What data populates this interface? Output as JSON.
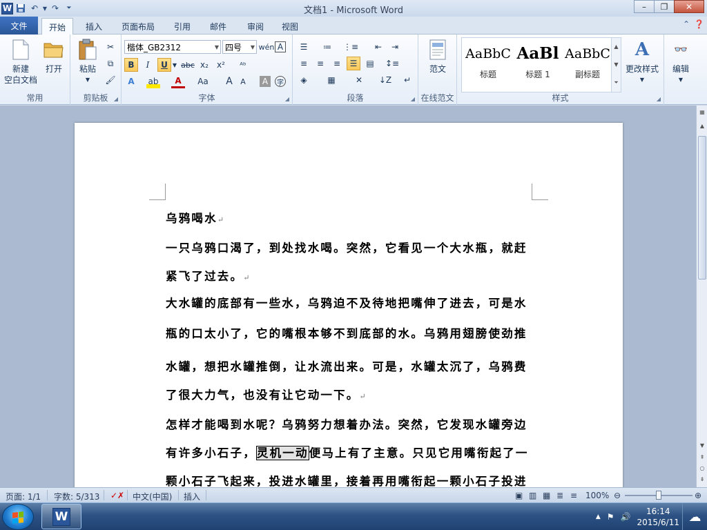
{
  "window": {
    "title": "文档1 - Microsoft Word",
    "app_icon": "word-icon"
  },
  "qat": {
    "icons": [
      "save-icon",
      "undo-icon",
      "redo-icon",
      "customize-qat-icon"
    ]
  },
  "tabs": {
    "file": "文件",
    "items": [
      {
        "label": "开始",
        "active": true
      },
      {
        "label": "插入"
      },
      {
        "label": "页面布局"
      },
      {
        "label": "引用"
      },
      {
        "label": "邮件"
      },
      {
        "label": "审阅"
      },
      {
        "label": "视图"
      }
    ]
  },
  "ribbon": {
    "groups": {
      "common": "常用",
      "clipboard": "剪贴板",
      "font": "字体",
      "paragraph": "段落",
      "online": "在线范文",
      "styles": "样式"
    },
    "new_blank_line1": "新建",
    "new_blank_line2": "空白文档",
    "open": "打开",
    "paste": "粘贴",
    "font_name": "楷体_GB2312",
    "font_size": "四号",
    "bold": "B",
    "italic": "I",
    "underline": "U",
    "strike": "abc",
    "subscript": "x₂",
    "superscript": "x²",
    "change_case": "Aa",
    "grow": "A",
    "shrink": "A",
    "sample_essay": "范文",
    "styles": [
      {
        "sample": "AaBbC",
        "name": "标题"
      },
      {
        "sample": "AaBl",
        "name": "标题 1"
      },
      {
        "sample": "AaBbC",
        "name": "副标题"
      }
    ],
    "change_styles": "更改样式",
    "edit": "编辑"
  },
  "document": {
    "title_line": "乌鸦喝水",
    "lines": [
      "一只乌鸦口渴了，到处找水喝。突然，它看见一个大水瓶，就赶",
      "紧飞了过去。",
      "大水罐的底部有一些水，乌鸦迫不及待地把嘴伸了进去，可是水",
      "瓶的口太小了，它的嘴根本够不到底部的水。乌鸦用翅膀使劲推",
      "水罐，想把水罐推倒，让水流出来。可是，水罐太沉了，乌鸦费",
      "了很大力气，也没有让它动一下。",
      "怎样才能喝到水呢？乌鸦努力想着办法。突然，它发现水罐旁边",
      "有许多小石子，",
      "灵机一动",
      "便马上有了主意。只见它用嘴衔起了一",
      "颗小石子飞起来，投进水罐里，接着再用嘴衔起一颗小石子投进"
    ],
    "para_mark": "↵"
  },
  "status": {
    "page": "页面: 1/1",
    "words": "字数: 5/313",
    "language": "中文(中国)",
    "mode": "插入",
    "zoom": "100%",
    "zoom_level": 1.0
  },
  "taskbar": {
    "time": "16:14",
    "date": "2015/6/11"
  },
  "colors": {
    "accent": "#2b579a",
    "ribbon_bg": "#e6eef8",
    "taskbar": "#1f4272"
  }
}
